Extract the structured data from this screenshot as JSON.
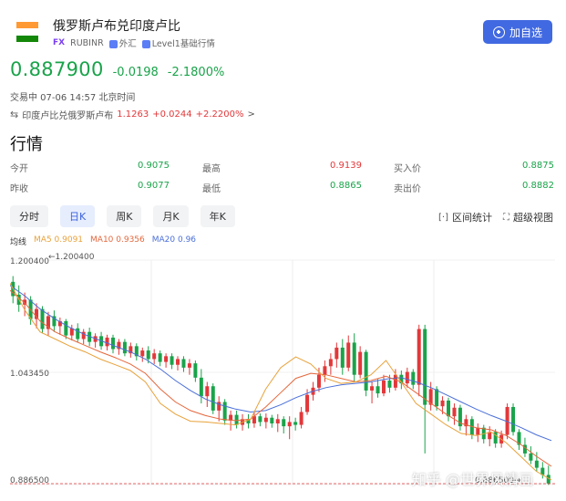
{
  "header": {
    "pair_name": "俄罗斯卢布兑印度卢比",
    "fx_badge": "FX",
    "code": "RUBINR",
    "category": "外汇",
    "level": "Level1基础行情",
    "add_button": "加自选",
    "flag_colors": [
      "#ff9933",
      "#ffffff",
      "#138808"
    ]
  },
  "quote": {
    "price": "0.887900",
    "change": "-0.0198",
    "change_pct": "-2.1800%",
    "status": "交易中 07-06 14:57 北京时间",
    "inverse": {
      "label": "印度卢比兑俄罗斯卢布",
      "price": "1.1263",
      "change": "+0.0244",
      "change_pct": "+2.2200%",
      "arrow": ">"
    }
  },
  "section_title": "行情",
  "stats": {
    "open_label": "今开",
    "open": "0.9075",
    "high_label": "最高",
    "high": "0.9139",
    "bid_label": "买入价",
    "bid": "0.8875",
    "prev_label": "昨收",
    "prev": "0.9077",
    "low_label": "最低",
    "low": "0.8865",
    "ask_label": "卖出价",
    "ask": "0.8882"
  },
  "tabs": [
    "分时",
    "日K",
    "周K",
    "月K",
    "年K"
  ],
  "active_tab": 1,
  "tools": {
    "interval": "区间统计",
    "super": "超级视图"
  },
  "ma": {
    "title": "均线",
    "ma5": "MA5 0.9091",
    "ma10": "MA10 0.9356",
    "ma20": "MA20 0.96"
  },
  "chart_data": {
    "type": "candlestick",
    "y_ticks": [
      "1.200400",
      "1.043450",
      "0.886500"
    ],
    "top_marker": "1.200400",
    "bottom_marker": "0.886500",
    "ylim": [
      0.8865,
      1.2004
    ],
    "colors": {
      "up": "#e2383a",
      "down": "#1aa34a",
      "ma5": "#e8a23a",
      "ma10": "#e5673c",
      "ma20": "#4a6fd8"
    },
    "candles": [
      [
        1.17,
        1.178,
        1.14,
        1.15
      ],
      [
        1.152,
        1.165,
        1.128,
        1.138
      ],
      [
        1.138,
        1.155,
        1.122,
        1.145
      ],
      [
        1.145,
        1.15,
        1.11,
        1.118
      ],
      [
        1.118,
        1.14,
        1.105,
        1.132
      ],
      [
        1.132,
        1.136,
        1.098,
        1.104
      ],
      [
        1.104,
        1.128,
        1.095,
        1.122
      ],
      [
        1.122,
        1.13,
        1.1,
        1.108
      ],
      [
        1.108,
        1.12,
        1.096,
        1.115
      ],
      [
        1.115,
        1.118,
        1.09,
        1.095
      ],
      [
        1.095,
        1.11,
        1.088,
        1.105
      ],
      [
        1.105,
        1.112,
        1.085,
        1.09
      ],
      [
        1.09,
        1.104,
        1.083,
        1.1
      ],
      [
        1.1,
        1.106,
        1.08,
        1.086
      ],
      [
        1.086,
        1.098,
        1.078,
        1.094
      ],
      [
        1.094,
        1.1,
        1.075,
        1.08
      ],
      [
        1.08,
        1.096,
        1.074,
        1.092
      ],
      [
        1.092,
        1.096,
        1.07,
        1.076
      ],
      [
        1.076,
        1.09,
        1.068,
        1.086
      ],
      [
        1.086,
        1.09,
        1.066,
        1.07
      ],
      [
        1.07,
        1.085,
        1.064,
        1.08
      ],
      [
        1.08,
        1.084,
        1.06,
        1.066
      ],
      [
        1.066,
        1.078,
        1.058,
        1.074
      ],
      [
        1.074,
        1.08,
        1.056,
        1.062
      ],
      [
        1.062,
        1.076,
        1.055,
        1.07
      ],
      [
        1.07,
        1.074,
        1.052,
        1.058
      ],
      [
        1.058,
        1.07,
        1.05,
        1.066
      ],
      [
        1.066,
        1.07,
        1.048,
        1.054
      ],
      [
        1.054,
        1.066,
        1.046,
        1.062
      ],
      [
        1.062,
        1.066,
        1.044,
        1.05
      ],
      [
        1.05,
        1.062,
        1.04,
        1.056
      ],
      [
        1.056,
        1.06,
        1.03,
        1.036
      ],
      [
        1.036,
        1.048,
        1.0,
        1.01
      ],
      [
        1.01,
        1.03,
        0.995,
        1.024
      ],
      [
        1.024,
        1.028,
        0.985,
        0.99
      ],
      [
        0.99,
        1.01,
        0.975,
        1.002
      ],
      [
        1.002,
        1.006,
        0.97,
        0.976
      ],
      [
        0.976,
        0.99,
        0.962,
        0.984
      ],
      [
        0.984,
        0.99,
        0.965,
        0.97
      ],
      [
        0.97,
        0.985,
        0.962,
        0.978
      ],
      [
        0.978,
        0.985,
        0.965,
        0.972
      ],
      [
        0.972,
        0.988,
        0.966,
        0.982
      ],
      [
        0.982,
        0.986,
        0.968,
        0.974
      ],
      [
        0.974,
        0.986,
        0.965,
        0.98
      ],
      [
        0.98,
        0.984,
        0.966,
        0.972
      ],
      [
        0.972,
        0.985,
        0.96,
        0.978
      ],
      [
        0.978,
        0.982,
        0.958,
        0.968
      ],
      [
        0.968,
        0.982,
        0.95,
        0.974
      ],
      [
        0.974,
        0.98,
        0.962,
        0.97
      ],
      [
        0.97,
        0.995,
        0.965,
        0.988
      ],
      [
        0.988,
        1.02,
        0.984,
        1.012
      ],
      [
        1.012,
        1.03,
        1.004,
        1.022
      ],
      [
        1.022,
        1.05,
        1.016,
        1.04
      ],
      [
        1.04,
        1.06,
        1.03,
        1.052
      ],
      [
        1.052,
        1.07,
        1.04,
        1.062
      ],
      [
        1.062,
        1.085,
        1.05,
        1.078
      ],
      [
        1.078,
        1.09,
        1.04,
        1.05
      ],
      [
        1.05,
        1.095,
        1.045,
        1.085
      ],
      [
        1.085,
        1.098,
        1.03,
        1.04
      ],
      [
        1.04,
        1.08,
        1.035,
        1.072
      ],
      [
        1.072,
        1.075,
        1.01,
        1.018
      ],
      [
        1.018,
        1.03,
        1.0,
        1.024
      ],
      [
        1.024,
        1.034,
        1.008,
        1.014
      ],
      [
        1.014,
        1.04,
        1.01,
        1.032
      ],
      [
        1.032,
        1.04,
        1.015,
        1.022
      ],
      [
        1.022,
        1.048,
        1.018,
        1.04
      ],
      [
        1.04,
        1.046,
        1.02,
        1.028
      ],
      [
        1.028,
        1.05,
        1.022,
        1.044
      ],
      [
        1.044,
        1.048,
        1.02,
        1.026
      ],
      [
        1.026,
        1.11,
        1.01,
        1.104
      ],
      [
        1.104,
        1.11,
        0.93,
        0.998
      ],
      [
        0.998,
        1.03,
        0.99,
        1.02
      ],
      [
        1.02,
        1.024,
        0.99,
        0.996
      ],
      [
        0.996,
        1.01,
        0.985,
        1.004
      ],
      [
        1.004,
        1.008,
        0.975,
        0.982
      ],
      [
        0.982,
        1.0,
        0.97,
        0.994
      ],
      [
        0.994,
        0.998,
        0.962,
        0.968
      ],
      [
        0.968,
        0.984,
        0.955,
        0.978
      ],
      [
        0.978,
        0.982,
        0.95,
        0.956
      ],
      [
        0.956,
        0.972,
        0.946,
        0.966
      ],
      [
        0.966,
        0.97,
        0.944,
        0.95
      ],
      [
        0.95,
        0.968,
        0.94,
        0.96
      ],
      [
        0.96,
        0.964,
        0.938,
        0.944
      ],
      [
        0.944,
        0.962,
        0.938,
        0.956
      ],
      [
        0.956,
        1.0,
        0.95,
        0.995
      ],
      [
        0.995,
        1.0,
        0.955,
        0.96
      ],
      [
        0.96,
        0.964,
        0.935,
        0.942
      ],
      [
        0.942,
        0.952,
        0.925,
        0.93
      ],
      [
        0.93,
        0.94,
        0.915,
        0.92
      ],
      [
        0.92,
        0.932,
        0.905,
        0.91
      ],
      [
        0.91,
        0.918,
        0.895,
        0.9
      ],
      [
        0.9,
        0.913,
        0.886,
        0.888
      ]
    ],
    "ma5": [
      1.168,
      1.13,
      1.1,
      1.09,
      1.08,
      1.072,
      1.062,
      1.054,
      1.046,
      1.03,
      1.0,
      0.985,
      0.975,
      0.974,
      0.972,
      0.97,
      0.978,
      1.02,
      1.05,
      1.065,
      1.055,
      1.035,
      1.028,
      1.03,
      1.04,
      1.06,
      1.03,
      1.0,
      0.985,
      0.97,
      0.958,
      0.955,
      0.96,
      0.945,
      0.925,
      0.905,
      0.893
    ],
    "ma10": [
      1.158,
      1.14,
      1.115,
      1.1,
      1.09,
      1.081,
      1.072,
      1.064,
      1.055,
      1.042,
      1.02,
      1.002,
      0.99,
      0.983,
      0.978,
      0.976,
      0.978,
      0.995,
      1.015,
      1.035,
      1.042,
      1.04,
      1.035,
      1.03,
      1.032,
      1.038,
      1.03,
      1.015,
      1.0,
      0.985,
      0.972,
      0.966,
      0.963,
      0.955,
      0.942,
      0.926,
      0.912
    ],
    "ma20": [
      1.165,
      1.15,
      1.132,
      1.118,
      1.106,
      1.096,
      1.088,
      1.08,
      1.072,
      1.062,
      1.048,
      1.032,
      1.018,
      1.006,
      0.998,
      0.992,
      0.988,
      0.99,
      0.998,
      1.008,
      1.016,
      1.022,
      1.026,
      1.028,
      1.03,
      1.034,
      1.036,
      1.03,
      1.022,
      1.012,
      1.002,
      0.992,
      0.983,
      0.975,
      0.966,
      0.956,
      0.948
    ]
  },
  "watermark": "知乎 @世界风情画"
}
